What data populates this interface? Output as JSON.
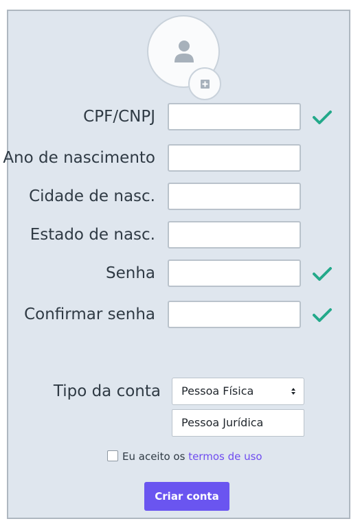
{
  "form": {
    "avatar": {
      "icon": "user-icon",
      "add_icon": "add-photo-icon"
    },
    "fields": [
      {
        "label": "CPF/CNPJ",
        "value": "",
        "valid": true
      },
      {
        "label": "Ano de nascimento",
        "value": "",
        "valid": false
      },
      {
        "label": "Cidade de nasc.",
        "value": "",
        "valid": false
      },
      {
        "label": "Estado de nasc.",
        "value": "",
        "valid": false
      },
      {
        "label": "Senha",
        "value": "",
        "valid": true
      },
      {
        "label": "Confirmar senha",
        "value": "",
        "valid": true
      }
    ],
    "account_type": {
      "label": "Tipo da conta",
      "selected": "Pessoa Física",
      "options": [
        "Pessoa Física",
        "Pessoa Jurídica"
      ]
    },
    "terms": {
      "checked": false,
      "prefix": "Eu aceito os",
      "link": "termos de uso"
    },
    "submit_label": "Criar conta"
  },
  "colors": {
    "panel_bg": "#dfe6ee",
    "check": "#23a98a",
    "link": "#6f4cf0",
    "button": "#6a55f0"
  }
}
